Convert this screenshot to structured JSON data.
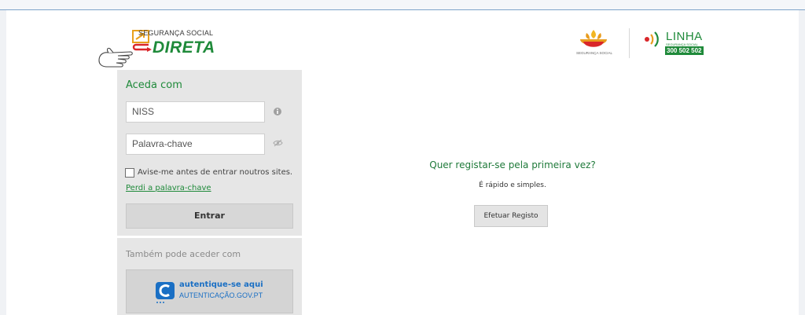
{
  "brand": {
    "small_text": "SEGURANÇA SOCIAL",
    "big_text": "DIRETA"
  },
  "logos": {
    "ss_caption": "SEGURANÇA SOCIAL",
    "linha_title": "LINHA",
    "linha_sub": "SEGURANÇA SOCIAL",
    "linha_number": "300 502 502"
  },
  "login": {
    "heading": "Aceda com",
    "niss_placeholder": "NISS",
    "password_placeholder": "Palavra-chave",
    "remember_label": "Avise-me antes de entrar noutros sites.",
    "forgot_link": "Perdi a palavra-chave",
    "enter_button": "Entrar",
    "alt_label": "Também pode aceder com",
    "auth_main": "autentique-se aqui",
    "auth_sub": "AUTENTICAÇÃO.GOV.PT"
  },
  "register": {
    "title": "Quer registar-se pela primeira vez?",
    "subtitle": "É rápido e simples.",
    "button": "Efetuar Registo"
  },
  "colors": {
    "brand_green": "#1f8a3a",
    "panel_grey": "#e6e6e6",
    "auth_blue": "#1a6fc4"
  }
}
